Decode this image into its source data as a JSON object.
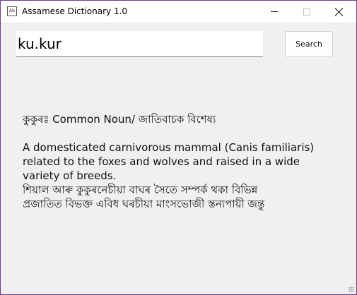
{
  "window": {
    "title": "Assamese Dictionary 1.0",
    "icon": "dictionary-app-icon",
    "icon_text": "Ab"
  },
  "search": {
    "value": "ku.kur",
    "button_label": "Search"
  },
  "result": {
    "headword_line": "কুকুৰঃ Common Noun/ জাতিবাচক বিশেষ্য",
    "english_lines": [
      "A domesticated carnivorous mammal (Canis familiaris)",
      "related to the foxes and wolves and raised in a wide",
      "variety of breeds."
    ],
    "assamese_lines": [
      "শিয়াল আৰু কুকুৰনেচীয়া বাঘৰ সৈতে সম্পৰ্ক থকা বিভিন্ন",
      "প্ৰজাতিত বিভক্ত এবিধ ঘৰচীয়া মাংসভোজী স্তন্যপায়ী জন্তু"
    ]
  },
  "colors": {
    "window_bg": "#f0f0f0",
    "titlebar_bg": "#ffffff",
    "desktop_bg": "#5b2d82"
  }
}
